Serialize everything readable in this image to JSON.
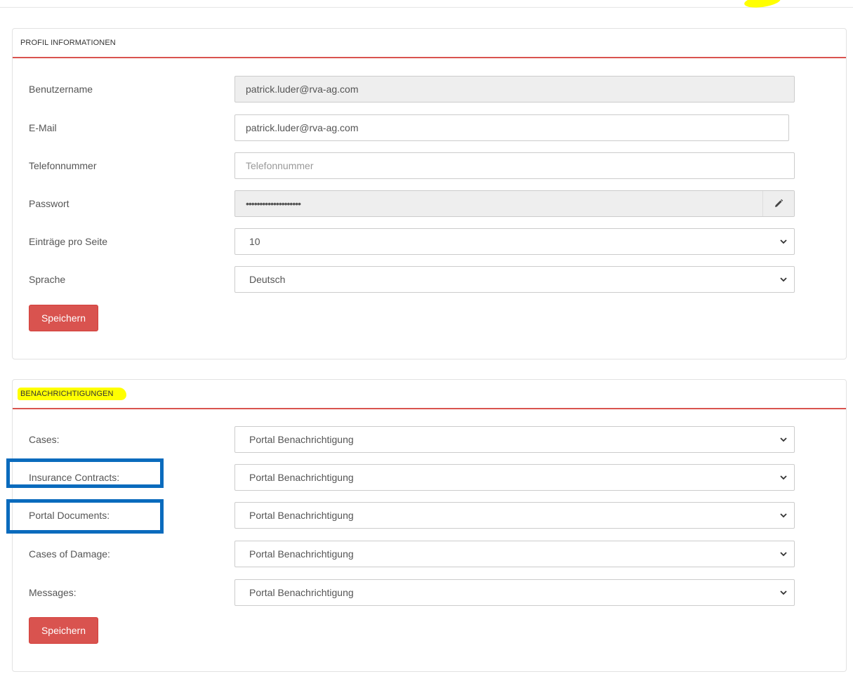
{
  "profile": {
    "header": "PROFIL INFORMATIONEN",
    "username_label": "Benutzername",
    "username_value": "patrick.luder@rva-ag.com",
    "email_label": "E-Mail",
    "email_value": "patrick.luder@rva-ag.com",
    "phone_label": "Telefonnummer",
    "phone_placeholder": "Telefonnummer",
    "password_label": "Passwort",
    "password_mask": "••••••••••••••••••••",
    "entries_label": "Einträge pro Seite",
    "entries_value": "10",
    "language_label": "Sprache",
    "language_value": "Deutsch",
    "save_label": "Speichern"
  },
  "notifications": {
    "header": "BENACHRICHTIGUNGEN",
    "rows": [
      {
        "label": "Cases:",
        "value": "Portal Benachrichtigung"
      },
      {
        "label": "Insurance Contracts:",
        "value": "Portal Benachrichtigung"
      },
      {
        "label": "Portal Documents:",
        "value": "Portal Benachrichtigung"
      },
      {
        "label": "Cases of Damage:",
        "value": "Portal Benachrichtigung"
      },
      {
        "label": "Messages:",
        "value": "Portal Benachrichtigung"
      }
    ],
    "save_label": "Speichern"
  },
  "colors": {
    "accent": "#d9534f",
    "highlight": "#ffff00",
    "annotation_box": "#0a6bbd"
  },
  "icons": {
    "password_edit": "pencil-icon",
    "select_arrow": "chevron-down-icon"
  }
}
